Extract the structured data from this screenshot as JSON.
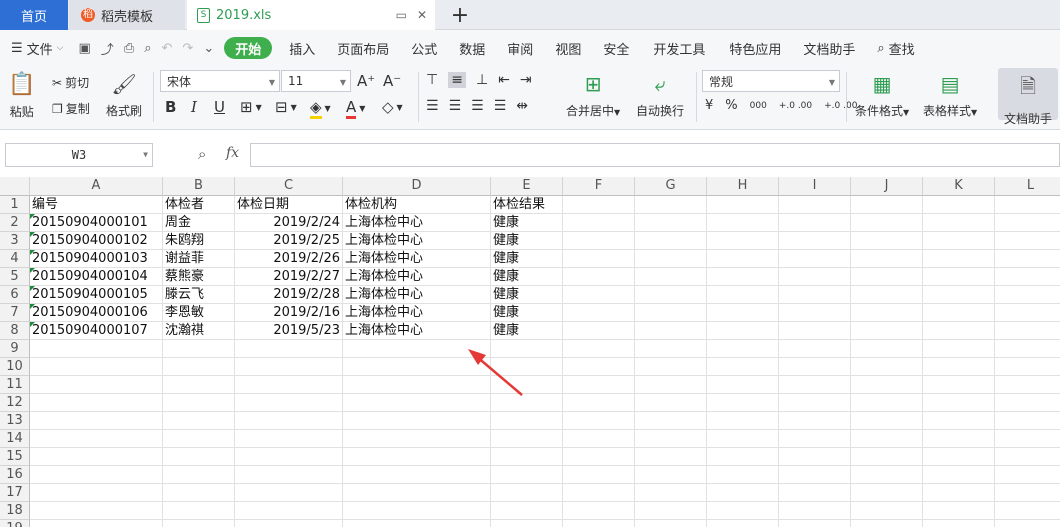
{
  "tabs": {
    "home": "首页",
    "template": "稻壳模板",
    "file": "2019.xls"
  },
  "menu": {
    "file": "文件",
    "items": [
      "开始",
      "插入",
      "页面布局",
      "公式",
      "数据",
      "审阅",
      "视图",
      "安全",
      "开发工具",
      "特色应用",
      "文档助手"
    ],
    "search": "查找"
  },
  "toolbar": {
    "paste": "粘贴",
    "cut": "剪切",
    "copy": "复制",
    "format_painter": "格式刷",
    "font": "宋体",
    "size": "11",
    "merge": "合并居中",
    "wrap": "自动换行",
    "number_format": "常规",
    "cond_format": "条件格式",
    "table_style": "表格样式",
    "doc_helper": "文档助手",
    "bold": "B",
    "italic": "I",
    "underline": "U",
    "grow": "A⁺",
    "shrink": "A⁻",
    "currency": "¥",
    "percent": "%",
    "thousands": "000",
    "inc_dec": "+.0 .00",
    "dec_dec": "+.0 .00"
  },
  "formula": {
    "cell_ref": "W3",
    "fx": "fx",
    "value": ""
  },
  "columns": [
    "A",
    "B",
    "C",
    "D",
    "E",
    "F",
    "G",
    "H",
    "I",
    "J",
    "K",
    "L"
  ],
  "rows": [
    "1",
    "2",
    "3",
    "4",
    "5",
    "6",
    "7",
    "8",
    "9",
    "10",
    "11",
    "12",
    "13",
    "14",
    "15",
    "16",
    "17",
    "18",
    "19"
  ],
  "cells": [
    [
      "编号",
      "体检者",
      "体检日期",
      "体检机构",
      "体检结果"
    ],
    [
      "20150904000101",
      "周金",
      "2019/2/24",
      "上海体检中心",
      "健康"
    ],
    [
      "20150904000102",
      "朱鸥翔",
      "2019/2/25",
      "上海体检中心",
      "健康"
    ],
    [
      "20150904000103",
      "谢益菲",
      "2019/2/26",
      "上海体检中心",
      "健康"
    ],
    [
      "20150904000104",
      "蔡熊豪",
      "2019/2/27",
      "上海体检中心",
      "健康"
    ],
    [
      "20150904000105",
      "滕云飞",
      "2019/2/28",
      "上海体检中心",
      "健康"
    ],
    [
      "20150904000106",
      "李恩敏",
      "2019/2/16",
      "上海体检中心",
      "健康"
    ],
    [
      "20150904000107",
      "沈瀚祺",
      "2019/5/23",
      "上海体检中心",
      "健康"
    ]
  ],
  "colors": {
    "accent": "#3fae4d",
    "tab_home": "#2e6fd6",
    "arrow": "#e53935"
  }
}
